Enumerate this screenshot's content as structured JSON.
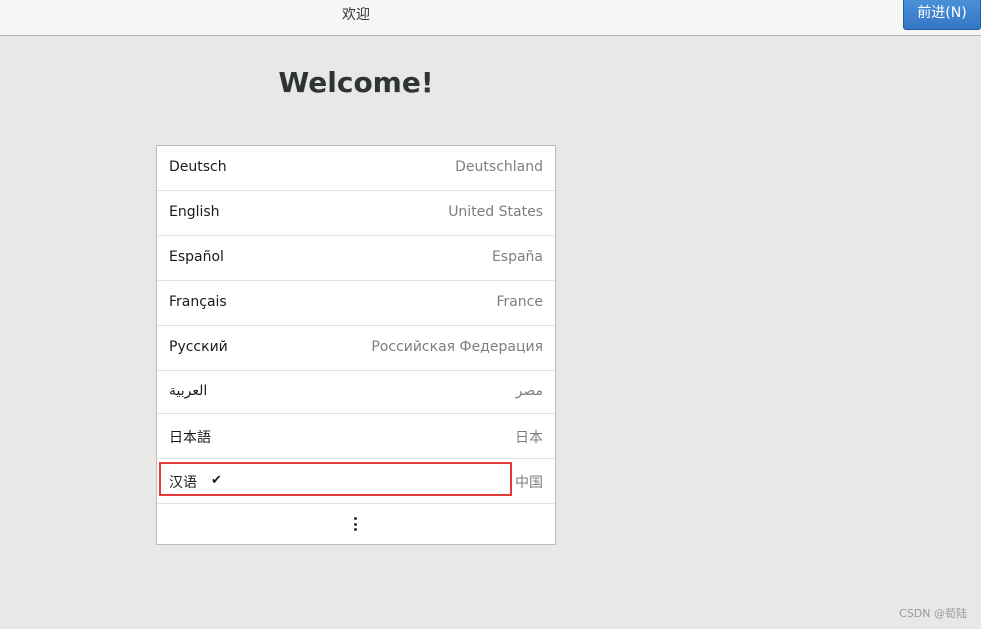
{
  "header": {
    "title": "欢迎",
    "next_label": "前进(N)"
  },
  "welcome": {
    "title": "Welcome!"
  },
  "languages": [
    {
      "name": "Deutsch",
      "region": "Deutschland"
    },
    {
      "name": "English",
      "region": "United States"
    },
    {
      "name": "Español",
      "region": "España"
    },
    {
      "name": "Français",
      "region": "France"
    },
    {
      "name": "Русский",
      "region": "Российская Федерация"
    },
    {
      "name": "العربية",
      "region": "مصر"
    },
    {
      "name": "日本語",
      "region": "日本"
    },
    {
      "name": "汉语",
      "region": "中国",
      "selected": true,
      "check": "✔"
    }
  ],
  "more": {
    "icon": "more-vertical-icon"
  },
  "watermark": "CSDN @荀陆",
  "colors": {
    "accent": "#3476c4",
    "highlight": "#e53a3a"
  }
}
